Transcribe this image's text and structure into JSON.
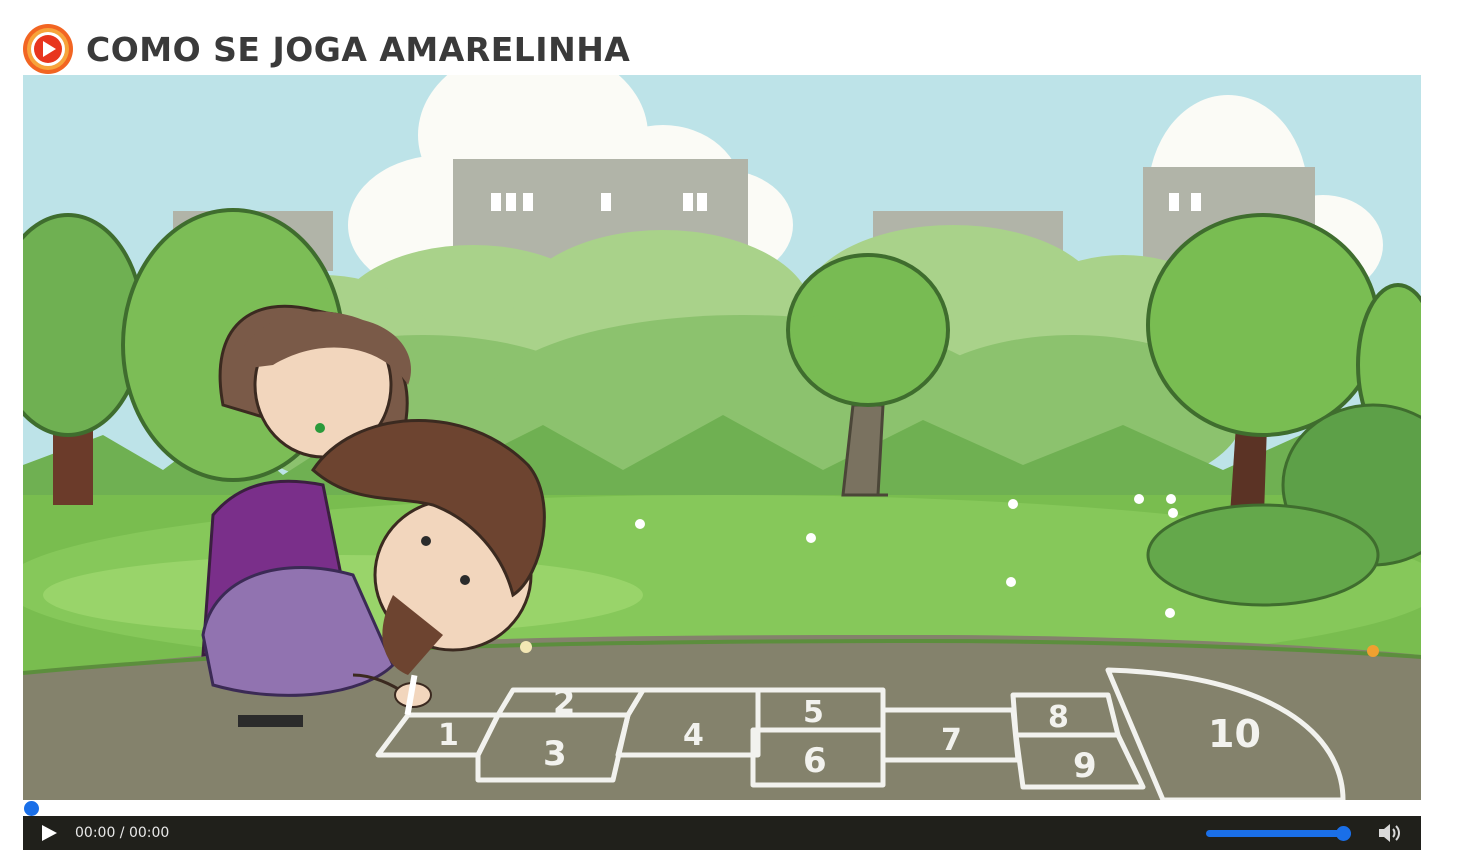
{
  "page": {
    "title": "COMO SE JOGA AMARELINHA",
    "title_icon": "orange-play-icon",
    "accent_color": "#1a6fe8",
    "brand_color": "#f26522"
  },
  "video": {
    "hopscotch_numbers": [
      "1",
      "2",
      "3",
      "4",
      "5",
      "6",
      "7",
      "8",
      "9",
      "10"
    ],
    "progress_percent": 0
  },
  "player": {
    "play_icon": "play-icon",
    "time_display": "00:00 / 00:00",
    "volume_icon": "speaker-icon",
    "volume_level": 1.0
  }
}
